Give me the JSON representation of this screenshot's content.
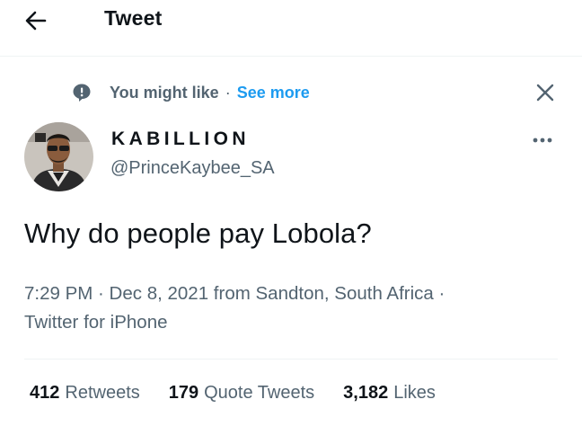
{
  "header": {
    "title": "Tweet",
    "back_icon": "arrow-left-icon"
  },
  "recommendation": {
    "label": "You might like",
    "separator": "·",
    "see_more": "See more",
    "icon": "speech-bubble-icon",
    "close_icon": "close-icon"
  },
  "author": {
    "display_name": "KABILLION",
    "handle": "@PrinceKaybee_SA",
    "more_icon": "more-dots-icon"
  },
  "tweet": {
    "text": "Why do people pay Lobola?",
    "meta_line": "7:29 PM · Dec 8, 2021 from Sandton, South Africa · Twitter for iPhone"
  },
  "stats": {
    "retweets_count": "412",
    "retweets_label": "Retweets",
    "quotes_count": "179",
    "quotes_label": "Quote Tweets",
    "likes_count": "3,182",
    "likes_label": "Likes"
  },
  "colors": {
    "accent": "#1d9bf0",
    "text_primary": "#0f1419",
    "text_secondary": "#536471",
    "divider": "#eff3f4"
  }
}
